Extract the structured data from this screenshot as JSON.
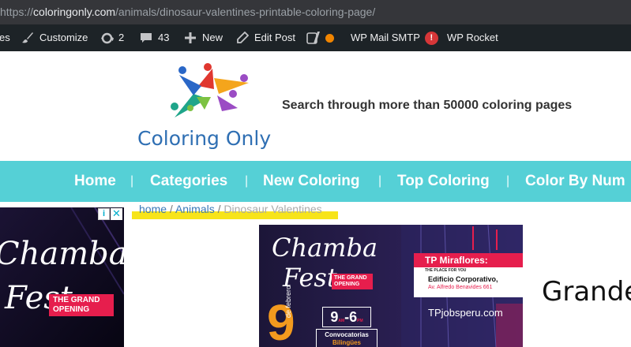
{
  "browser": {
    "url_prefix": "https://",
    "url_host": "coloringonly.com",
    "url_path": "/animals/dinosaur-valentines-printable-coloring-page/"
  },
  "admin_bar": {
    "first_label": "es",
    "customize": "Customize",
    "updates_count": "2",
    "comments_count": "43",
    "new_label": "New",
    "edit_post": "Edit Post",
    "wp_mail_smtp": "WP Mail SMTP",
    "wp_mail_smtp_badge": "!",
    "wp_rocket": "WP Rocket"
  },
  "site": {
    "logo_text": "Coloring Only",
    "tagline": "Search through more than 50000 coloring pages",
    "colors": {
      "nav_bg": "#55d0d6",
      "logo_text": "#2f6fb3",
      "highlight": "#f7e41a"
    }
  },
  "nav": {
    "items": [
      "Home",
      "Categories",
      "New Coloring",
      "Top Coloring",
      "Color By Num"
    ],
    "separator": "|"
  },
  "breadcrumb": {
    "home": "home",
    "animals": "Animals",
    "current": "Dinosaur Valentines",
    "separator": "/"
  },
  "ads": {
    "left": {
      "headline_1": "Chamba",
      "headline_2": "Fest",
      "ribbon_1": "THE GRAND",
      "ribbon_2": "OPENING",
      "info_icon": "i",
      "close_icon": "✕"
    },
    "center": {
      "headline_1": "Chamba",
      "headline_2": "Fest",
      "ribbon_1": "THE GRAND",
      "ribbon_2": "OPENING",
      "day": "9",
      "month": "de febrero",
      "hours_start": "9",
      "hours_start_suffix": "AM",
      "hours_end": "6",
      "hours_end_suffix": "PM",
      "convocatorias": "Convocatorias",
      "bilingues": "Bilingües",
      "location_title": "TP Miraflores:",
      "location_sub": "THE PLACE FOR YOU",
      "building": "Edificio Corporativo,",
      "address": "Av. Alfredo Benavides 661",
      "website": "TPjobsperu.com"
    }
  },
  "page_title": "Grande"
}
